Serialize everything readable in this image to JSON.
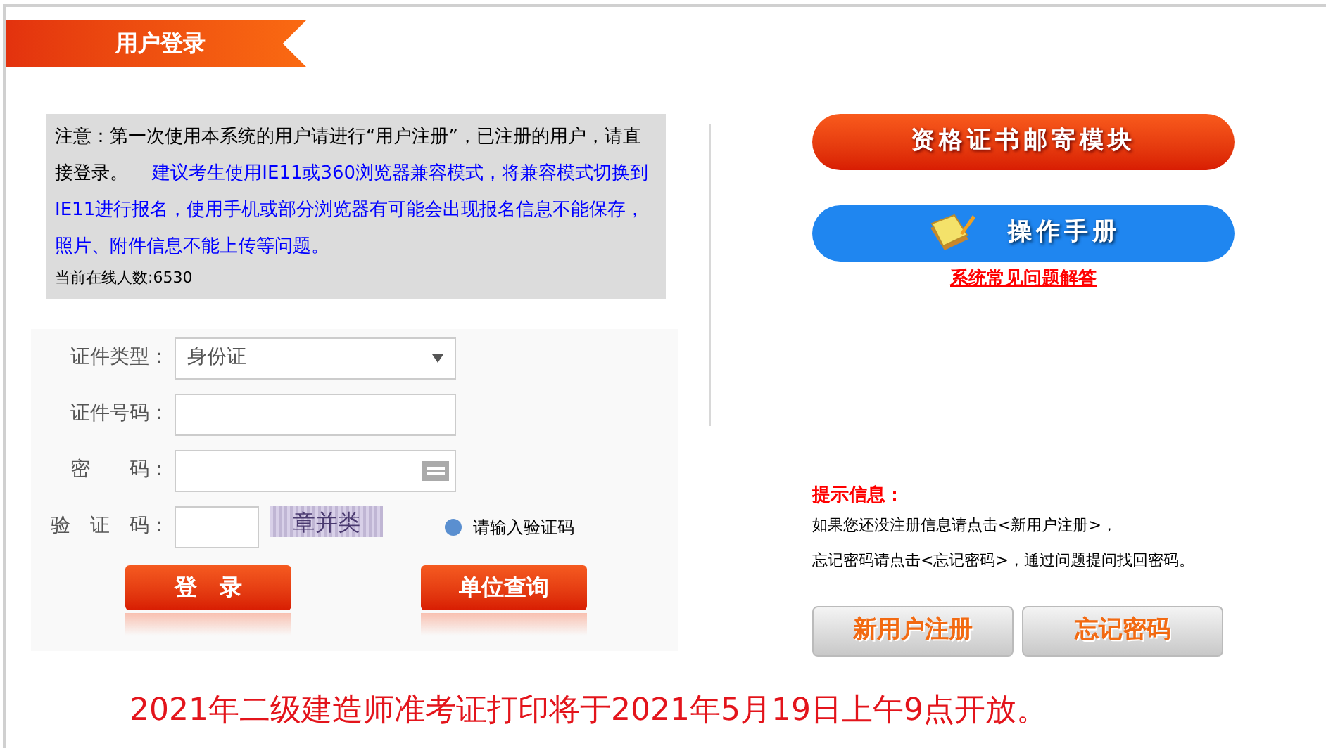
{
  "header": {
    "title": "用户登录"
  },
  "notice": {
    "text": "注意：第一次使用本系统的用户请进行“用户注册”，已注册的用户，请直接登录。",
    "advice": "建议考生使用IE11或360浏览器兼容模式，将兼容模式切换到IE11进行报名，使用手机或部分浏览器有可能会出现报名信息不能保存，照片、附件信息不能上传等问题。",
    "online": "当前在线人数:6530"
  },
  "form": {
    "fields": [
      {
        "kind": "select",
        "label": "证件类型：",
        "value": "身份证"
      },
      {
        "kind": "text",
        "label": "证件号码："
      },
      {
        "kind": "password",
        "label": "密　　码："
      },
      {
        "kind": "captcha",
        "label": "验　证　码：",
        "captcha": "章并类",
        "hint": "请输入验证码"
      }
    ],
    "buttons": [
      "登　录",
      "单位查询"
    ]
  },
  "right": {
    "mail_button": "资格证书邮寄模块",
    "manual_button": "操作手册",
    "faq_link": "系统常见问题解答",
    "tips_title": "提示信息：",
    "tips": [
      "如果您还没注册信息请点击<新用户注册>，",
      "忘记密码请点击<忘记密码>，通过问题提问找回密码。"
    ],
    "buttons": [
      "新用户注册",
      "忘记密码"
    ]
  },
  "announcement": "2021年二级建造师准考证打印将于2021年5月19日上午9点开放。"
}
